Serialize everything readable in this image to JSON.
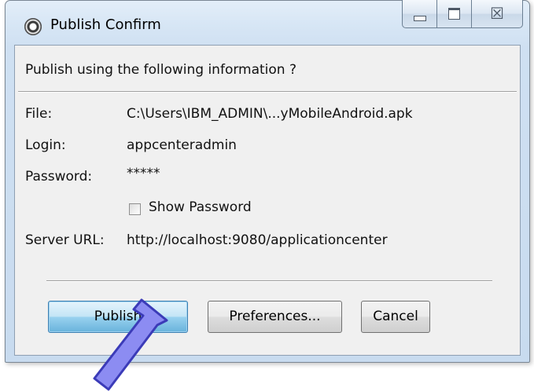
{
  "window": {
    "title": "Publish Confirm",
    "icon": "gear-app-icon"
  },
  "title_bar_buttons": {
    "minimize_icon": "minimize-icon",
    "maximize_icon": "maximize-icon",
    "close_glyph": "☒"
  },
  "dialog": {
    "prompt": "Publish using the following information ?",
    "fields": {
      "file": {
        "label": "File:",
        "value": "C:\\Users\\IBM_ADMIN\\...yMobileAndroid.apk"
      },
      "login": {
        "label": "Login:",
        "value": "appcenteradmin"
      },
      "password": {
        "label": "Password:",
        "value": "*****"
      },
      "server_url": {
        "label": "Server URL:",
        "value": "http://localhost:9080/applicationcenter"
      }
    },
    "show_password": {
      "label": "Show Password",
      "checked": false
    }
  },
  "buttons": {
    "publish": "Publish",
    "preferences": "Preferences...",
    "cancel": "Cancel"
  },
  "colors": {
    "title_bar": "#d7e6f5",
    "client_bg": "#f0f0f0",
    "primary_button": "#98d1ef",
    "pointer_arrow": "#8c8cf2"
  }
}
